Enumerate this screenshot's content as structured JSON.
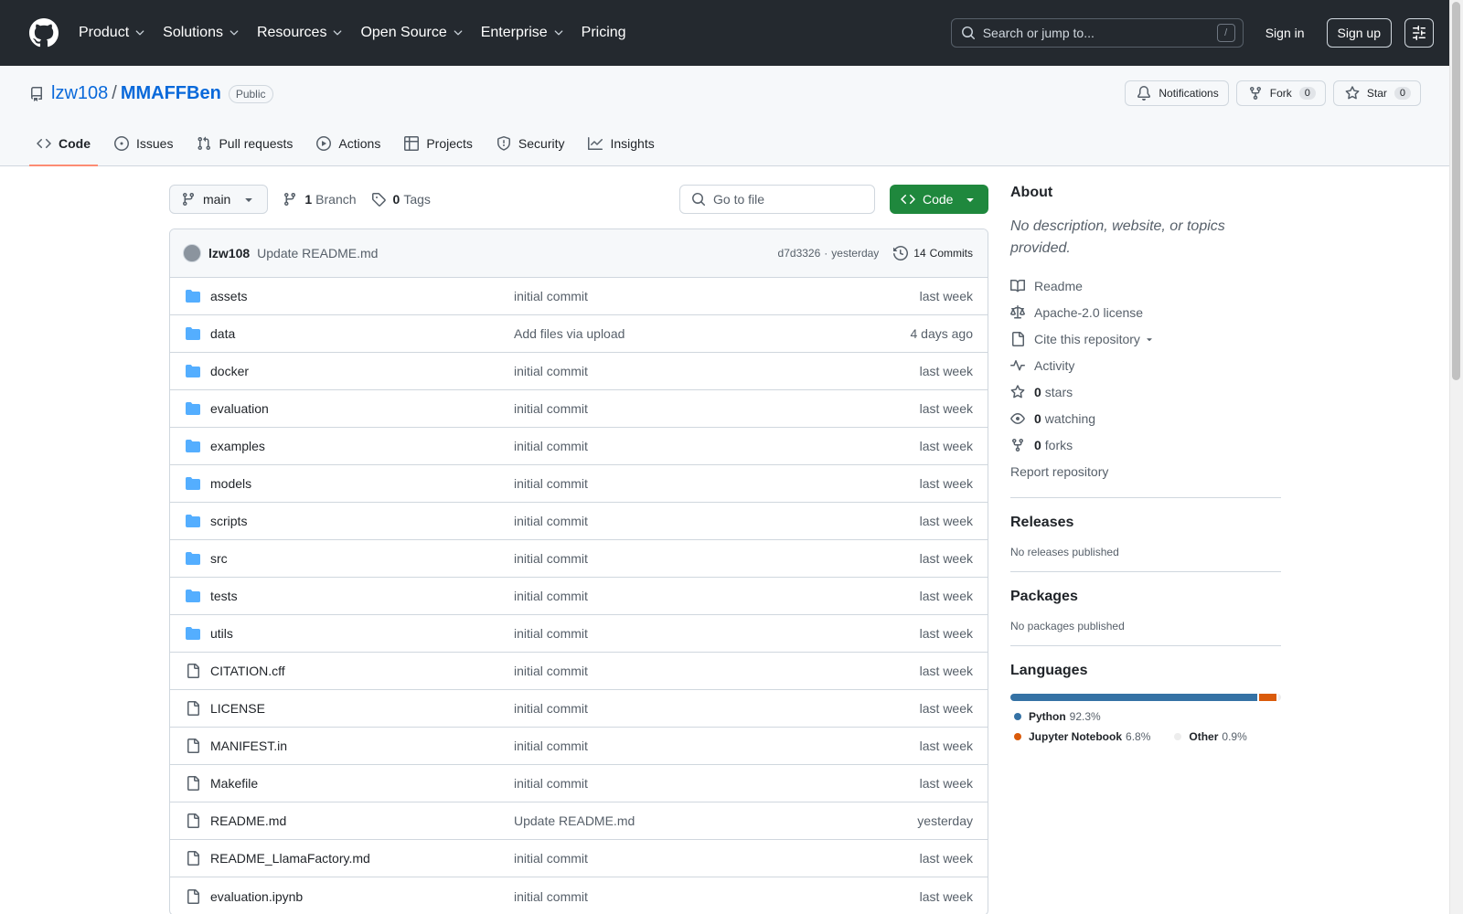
{
  "header": {
    "logo": "github-mark-icon",
    "nav": [
      "Product",
      "Solutions",
      "Resources",
      "Open Source",
      "Enterprise",
      "Pricing"
    ],
    "nav_dropdown": [
      true,
      true,
      true,
      true,
      true,
      false
    ],
    "search_placeholder": "Search or jump to...",
    "search_shortcut": "/",
    "signin": "Sign in",
    "signup": "Sign up"
  },
  "repo": {
    "owner": "lzw108",
    "separator": "/",
    "name": "MMAFFBen",
    "visibility": "Public",
    "notifications_label": "Notifications",
    "fork_label": "Fork",
    "fork_count": "0",
    "star_label": "Star",
    "star_count": "0",
    "tabs": [
      "Code",
      "Issues",
      "Pull requests",
      "Actions",
      "Projects",
      "Security",
      "Insights"
    ],
    "active_tab": "Code"
  },
  "toolbar": {
    "branch": "main",
    "branch_count": "1",
    "branch_label": "Branch",
    "tag_count": "0",
    "tag_label": "Tags",
    "goto_placeholder": "Go to file",
    "code_button": "Code"
  },
  "latest_commit": {
    "author": "lzw108",
    "message": "Update README.md",
    "hash": "d7d3326",
    "separator": "·",
    "time": "yesterday",
    "commits_count": "14",
    "commits_label": "Commits"
  },
  "files": [
    {
      "type": "dir",
      "name": "assets",
      "message": "initial commit",
      "date": "last week"
    },
    {
      "type": "dir",
      "name": "data",
      "message": "Add files via upload",
      "date": "4 days ago"
    },
    {
      "type": "dir",
      "name": "docker",
      "message": "initial commit",
      "date": "last week"
    },
    {
      "type": "dir",
      "name": "evaluation",
      "message": "initial commit",
      "date": "last week"
    },
    {
      "type": "dir",
      "name": "examples",
      "message": "initial commit",
      "date": "last week"
    },
    {
      "type": "dir",
      "name": "models",
      "message": "initial commit",
      "date": "last week"
    },
    {
      "type": "dir",
      "name": "scripts",
      "message": "initial commit",
      "date": "last week"
    },
    {
      "type": "dir",
      "name": "src",
      "message": "initial commit",
      "date": "last week"
    },
    {
      "type": "dir",
      "name": "tests",
      "message": "initial commit",
      "date": "last week"
    },
    {
      "type": "dir",
      "name": "utils",
      "message": "initial commit",
      "date": "last week"
    },
    {
      "type": "file",
      "name": "CITATION.cff",
      "message": "initial commit",
      "date": "last week"
    },
    {
      "type": "file",
      "name": "LICENSE",
      "message": "initial commit",
      "date": "last week"
    },
    {
      "type": "file",
      "name": "MANIFEST.in",
      "message": "initial commit",
      "date": "last week"
    },
    {
      "type": "file",
      "name": "Makefile",
      "message": "initial commit",
      "date": "last week"
    },
    {
      "type": "file",
      "name": "README.md",
      "message": "Update README.md",
      "date": "yesterday"
    },
    {
      "type": "file",
      "name": "README_LlamaFactory.md",
      "message": "initial commit",
      "date": "last week"
    },
    {
      "type": "file",
      "name": "evaluation.ipynb",
      "message": "initial commit",
      "date": "last week"
    }
  ],
  "about": {
    "heading": "About",
    "description": "No description, website, or topics provided.",
    "readme": "Readme",
    "license": "Apache-2.0 license",
    "cite": "Cite this repository",
    "activity": "Activity",
    "stars_count": "0",
    "stars_label": "stars",
    "watching_count": "0",
    "watching_label": "watching",
    "forks_count": "0",
    "forks_label": "forks",
    "report": "Report repository"
  },
  "releases": {
    "heading": "Releases",
    "text": "No releases published"
  },
  "packages": {
    "heading": "Packages",
    "text": "No packages published"
  },
  "languages": {
    "heading": "Languages",
    "items": [
      {
        "name": "Python",
        "percent": "92.3%",
        "share": 92.3,
        "color": "#3572A5"
      },
      {
        "name": "Jupyter Notebook",
        "percent": "6.8%",
        "share": 6.8,
        "color": "#DA5B0B"
      },
      {
        "name": "Other",
        "percent": "0.9%",
        "share": 0.9,
        "color": "#ededed"
      }
    ]
  },
  "colors": {
    "header_bg": "#24292f",
    "link": "#0969da",
    "primary_button": "#1f883d",
    "active_tab_underline": "#fd8c73",
    "folder": "#54aeff"
  }
}
